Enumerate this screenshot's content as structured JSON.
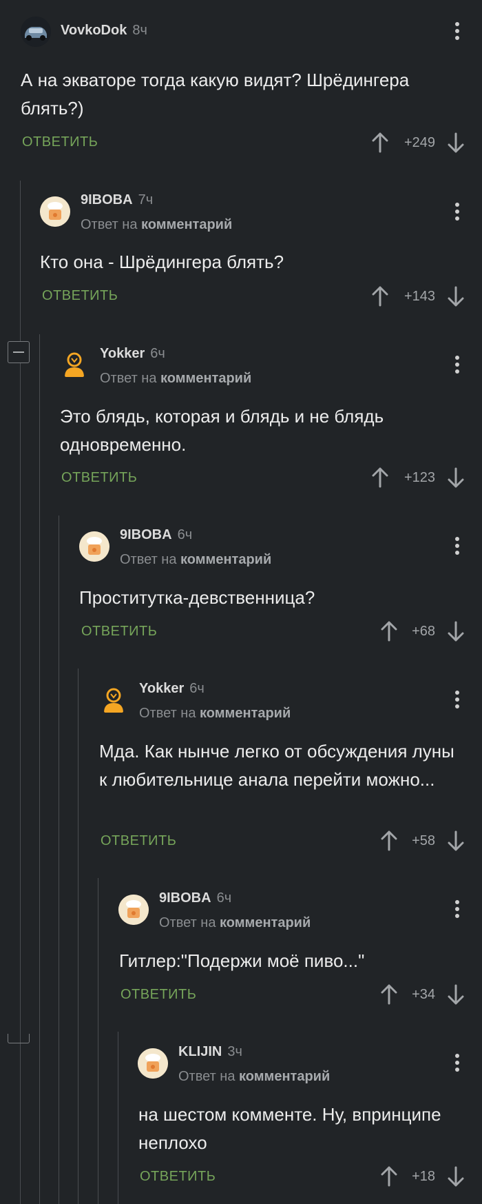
{
  "comments": [
    {
      "user": "VovkoDok",
      "time": "8ч",
      "reply_prefix": "",
      "reply_link": "",
      "text": "А на экваторе тогда какую видят? Шрёдингера блять?)",
      "reply_label": "ОТВЕТИТЬ",
      "score": "+249",
      "avatar": "car"
    },
    {
      "user": "9IBOBA",
      "time": "7ч",
      "reply_prefix": "Ответ на",
      "reply_link": "комментарий",
      "text": "Кто она - Шрёдингера блять?",
      "reply_label": "ОТВЕТИТЬ",
      "score": "+143",
      "avatar": "chef"
    },
    {
      "user": "Yokker",
      "time": "6ч",
      "reply_prefix": "Ответ на",
      "reply_link": "комментарий",
      "text": "Это блядь, которая и блядь и не блядь одновременно.",
      "reply_label": "ОТВЕТИТЬ",
      "score": "+123",
      "avatar": "yokker"
    },
    {
      "user": "9IBOBA",
      "time": "6ч",
      "reply_prefix": "Ответ на",
      "reply_link": "комментарий",
      "text": "Проститутка-девственница?",
      "reply_label": "ОТВЕТИТЬ",
      "score": "+68",
      "avatar": "chef"
    },
    {
      "user": "Yokker",
      "time": "6ч",
      "reply_prefix": "Ответ на",
      "reply_link": "комментарий",
      "text": "Мда. Как нынче легко от обсуждения луны к любительнице анала перейти можно...",
      "reply_label": "ОТВЕТИТЬ",
      "score": "+58",
      "avatar": "yokker"
    },
    {
      "user": "9IBOBA",
      "time": "6ч",
      "reply_prefix": "Ответ на",
      "reply_link": "комментарий",
      "text": "Гитлер:\"Подержи моё пиво...\"",
      "reply_label": "ОТВЕТИТЬ",
      "score": "+34",
      "avatar": "chef"
    },
    {
      "user": "KLIJIN",
      "time": "3ч",
      "reply_prefix": "Ответ на",
      "reply_link": "комментарий",
      "text": "на шестом комменте. Ну, впринципе неплохо",
      "reply_label": "ОТВЕТИТЬ",
      "score": "+18",
      "avatar": "chef"
    }
  ],
  "icons": {
    "more": "more-vertical-icon",
    "up": "arrow-up-icon",
    "down": "arrow-down-icon",
    "collapse": "collapse-minus-icon"
  },
  "colors": {
    "background": "#212427",
    "reply_green": "#76a55a",
    "text": "#ececec",
    "muted": "#8a8d90"
  }
}
